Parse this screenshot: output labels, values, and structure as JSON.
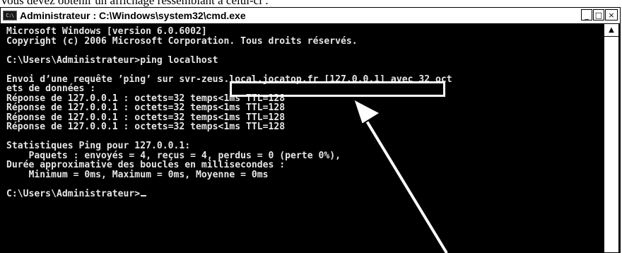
{
  "caption": "Vous devez obtenir un affichage ressemblant à celui-ci :",
  "window": {
    "title": "Administrateur : C:\\Windows\\system32\\cmd.exe",
    "icon_text": "C:\\",
    "controls": {
      "minimize": "_",
      "maximize": "□",
      "close": "×"
    }
  },
  "console": {
    "lines": [
      "Microsoft Windows [version 6.0.6002]",
      "Copyright (c) 2006 Microsoft Corporation. Tous droits réservés.",
      "",
      "C:\\Users\\Administrateur>ping localhost",
      "",
      "Envoi d’une requête ’ping’ sur svr-zeus.local.jocatop.fr [127.0.0.1] avec 32 oct",
      "ets de données :",
      "Réponse de 127.0.0.1 : octets=32 temps<1ms TTL=128",
      "Réponse de 127.0.0.1 : octets=32 temps<1ms TTL=128",
      "Réponse de 127.0.0.1 : octets=32 temps<1ms TTL=128",
      "Réponse de 127.0.0.1 : octets=32 temps<1ms TTL=128",
      "",
      "Statistiques Ping pour 127.0.0.1:",
      "    Paquets : envoyés = 4, reçus = 4, perdus = 0 (perte 0%),",
      "Durée approximative des boucles en millisecondes :",
      "    Minimum = 0ms, Maximum = 0ms, Moyenne = 0ms",
      "",
      "C:\\Users\\Administrateur>"
    ]
  },
  "scrollbar": {
    "up_arrow": "▲"
  },
  "colors": {
    "console_bg": "#000000",
    "console_text": "#e6e6e6",
    "annotation": "#ffffff"
  }
}
